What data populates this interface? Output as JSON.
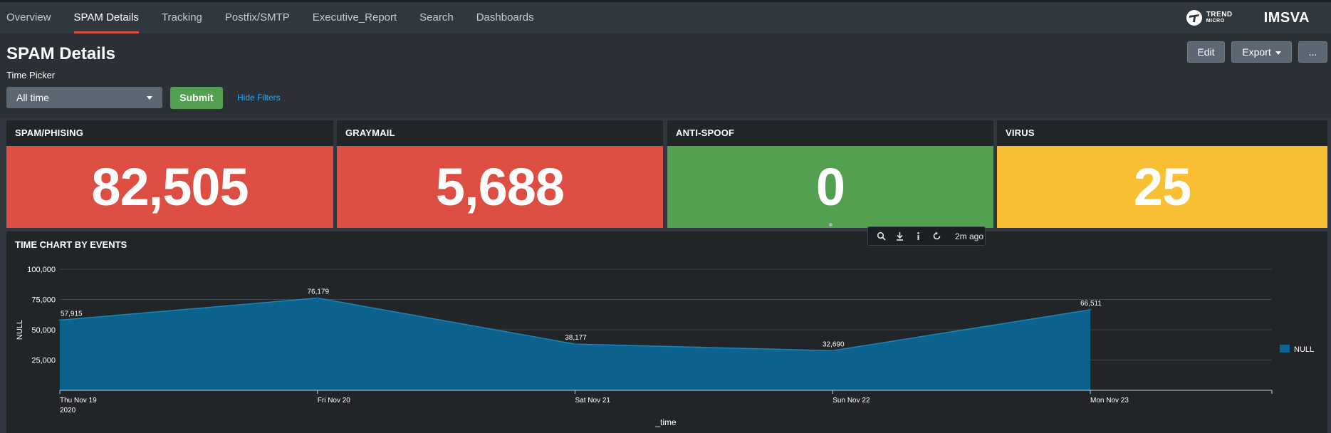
{
  "nav": {
    "items": [
      "Overview",
      "SPAM Details",
      "Tracking",
      "Postfix/SMTP",
      "Executive_Report",
      "Search",
      "Dashboards"
    ],
    "active": "SPAM Details"
  },
  "brand": {
    "trend_line1": "TREND",
    "trend_line2": "MICRO",
    "product": "IMSVA"
  },
  "page": {
    "title": "SPAM Details"
  },
  "actions": {
    "edit": "Edit",
    "export": "Export",
    "more": "..."
  },
  "filters": {
    "time_picker_label": "Time Picker",
    "time_value": "All time",
    "submit": "Submit",
    "hide_filters": "Hide Filters"
  },
  "panels": [
    {
      "title": "SPAM/PHISING",
      "value": "82,505",
      "color": "#dc4e41"
    },
    {
      "title": "GRAYMAIL",
      "value": "5,688",
      "color": "#dc4e41"
    },
    {
      "title": "ANTI-SPOOF",
      "value": "0",
      "color": "#53a051"
    },
    {
      "title": "VIRUS",
      "value": "25",
      "color": "#f8be34"
    }
  ],
  "toolbar": {
    "icons": [
      "search-icon",
      "download-icon",
      "info-icon",
      "refresh-icon"
    ],
    "time_ago": "2m ago"
  },
  "chart": {
    "title": "TIME CHART BY EVENTS"
  },
  "chart_data": {
    "type": "area",
    "x": [
      "Thu Nov 19",
      "Fri Nov 20",
      "Sat Nov 21",
      "Sun Nov 22",
      "Mon Nov 23"
    ],
    "x_sublabel": "2020",
    "series": [
      {
        "name": "NULL",
        "values": [
          57915,
          76179,
          38177,
          32690,
          66511
        ],
        "color": "#0c6591"
      }
    ],
    "data_labels": [
      "57,915",
      "76,179",
      "38,177",
      "32,690",
      "66,511"
    ],
    "yticks": [
      "25,000",
      "50,000",
      "75,000",
      "100,000"
    ],
    "ytick_values": [
      25000,
      50000,
      75000,
      100000
    ],
    "ylim": [
      0,
      100000
    ],
    "xlabel": "_time",
    "ylabel": "NULL",
    "legend_position": "right",
    "grid": true
  }
}
